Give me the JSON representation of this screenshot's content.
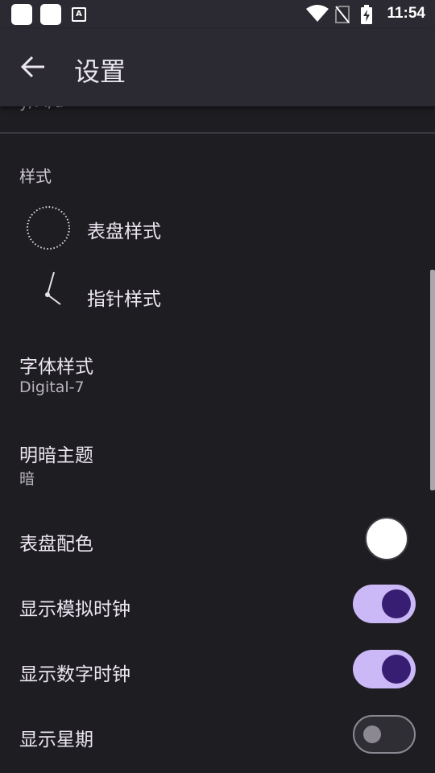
{
  "status_bar": {
    "time": "11:54",
    "icons": [
      "app-square-icon",
      "app-square-icon",
      "notification-a-icon",
      "wifi-icon",
      "no-sim-icon",
      "battery-charging-icon"
    ]
  },
  "app_bar": {
    "title": "设置",
    "back_icon": "arrow-left-icon"
  },
  "partial_item": {
    "subtitle": "y/M/d"
  },
  "style_section": {
    "header": "样式",
    "dial_style": "表盘样式",
    "hand_style": "指针样式"
  },
  "font_style": {
    "title": "字体样式",
    "value": "Digital-7"
  },
  "theme": {
    "title": "明暗主题",
    "value": "暗"
  },
  "dial_color": {
    "title": "表盘配色",
    "swatch_color": "#ffffff"
  },
  "toggles": {
    "analog_clock": {
      "label": "显示模拟时钟",
      "on": true
    },
    "digital_clock": {
      "label": "显示数字时钟",
      "on": true
    },
    "weekday": {
      "label": "显示星期",
      "on": false
    }
  },
  "colors": {
    "background": "#1e1d22",
    "app_bar": "#2b2a33",
    "toggle_track_on": "#cbb8f6",
    "toggle_thumb_on": "#381e72",
    "toggle_off": "#8c8891"
  }
}
